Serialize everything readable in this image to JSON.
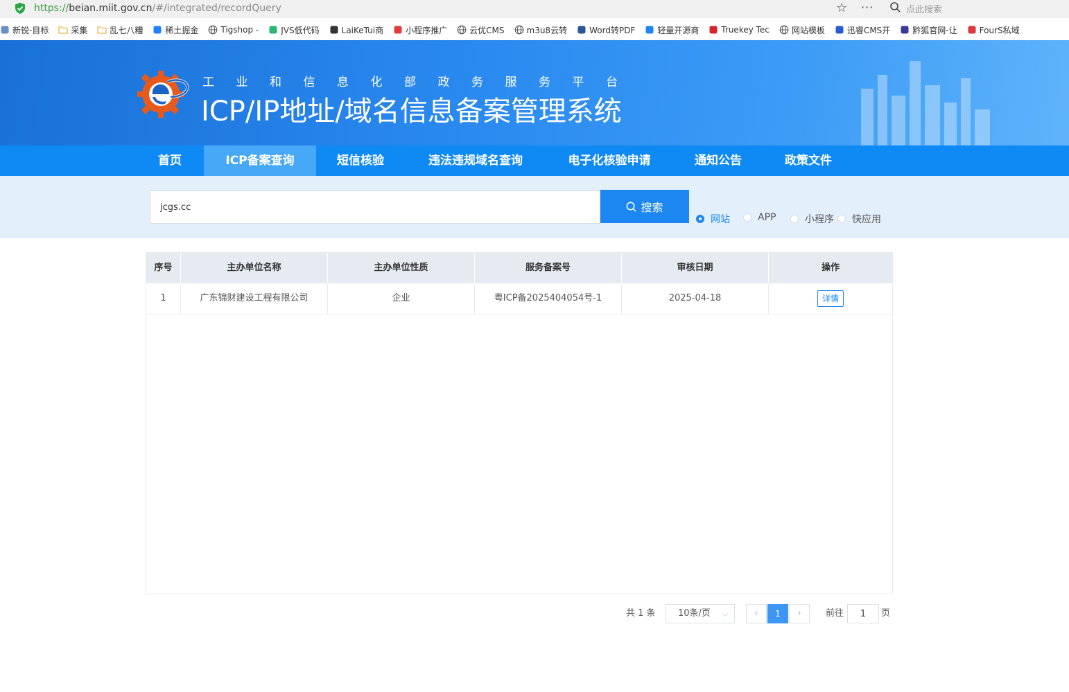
{
  "browser": {
    "url_scheme": "https://",
    "url_host": "beian.miit.gov.cn",
    "url_path": "/#/integrated/recordQuery",
    "search_placeholder": "点此搜索",
    "bookmarks": [
      {
        "label": "新锐-目标",
        "icon": "page-icon"
      },
      {
        "label": "采集",
        "icon": "folder-icon"
      },
      {
        "label": "乱七八糟",
        "icon": "folder-icon"
      },
      {
        "label": "稀土掘金",
        "icon": "juejin-icon"
      },
      {
        "label": "Tigshop -",
        "icon": "globe-icon"
      },
      {
        "label": "JVS低代码",
        "icon": "jvs-icon"
      },
      {
        "label": "LaiKeTui商",
        "icon": "laiketui-icon"
      },
      {
        "label": "小程序推广",
        "icon": "arrow-icon"
      },
      {
        "label": "云优CMS",
        "icon": "globe-icon"
      },
      {
        "label": "m3u8云转",
        "icon": "globe-icon"
      },
      {
        "label": "Word转PDF",
        "icon": "word-icon"
      },
      {
        "label": "轻量开源商",
        "icon": "circle-icon"
      },
      {
        "label": "Truekey Tec",
        "icon": "truekey-icon"
      },
      {
        "label": "网站模板",
        "icon": "globe-icon"
      },
      {
        "label": "迅睿CMS开",
        "icon": "xunrui-icon"
      },
      {
        "label": "黔狐官网-让",
        "icon": "fox-icon"
      },
      {
        "label": "FourS私域",
        "icon": "fours-icon"
      }
    ]
  },
  "header": {
    "platform": "工业和信息化部政务服务平台",
    "title": "ICP/IP地址/域名信息备案管理系统"
  },
  "nav": [
    {
      "label": "首页",
      "active": false
    },
    {
      "label": "ICP备案查询",
      "active": true
    },
    {
      "label": "短信核验",
      "active": false
    },
    {
      "label": "违法违规域名查询",
      "active": false
    },
    {
      "label": "电子化核验申请",
      "active": false
    },
    {
      "label": "通知公告",
      "active": false
    },
    {
      "label": "政策文件",
      "active": false
    }
  ],
  "search": {
    "value": "jcgs.cc",
    "button_label": "搜索",
    "types": [
      {
        "label": "网站",
        "checked": true
      },
      {
        "label": "APP",
        "checked": false
      },
      {
        "label": "小程序",
        "checked": false
      },
      {
        "label": "快应用",
        "checked": false
      }
    ]
  },
  "table": {
    "headers": [
      "序号",
      "主办单位名称",
      "主办单位性质",
      "服务备案号",
      "审核日期",
      "操作"
    ],
    "rows": [
      {
        "index": "1",
        "unit_name": "广东锦财建设工程有限公司",
        "unit_type": "企业",
        "record_no": "粤ICP备2025404054号-1",
        "date": "2025-04-18",
        "action": "详情"
      }
    ]
  },
  "pagination": {
    "total": "共 1 条",
    "page_size": "10条/页",
    "current_page": "1",
    "goto_prefix": "前往",
    "goto_value": "1",
    "goto_suffix": "页"
  },
  "colors": {
    "nav": "#0f8af5",
    "accent": "#1c87f0",
    "search_band": "#e3f0fc",
    "table_header": "#e6ebf1"
  }
}
